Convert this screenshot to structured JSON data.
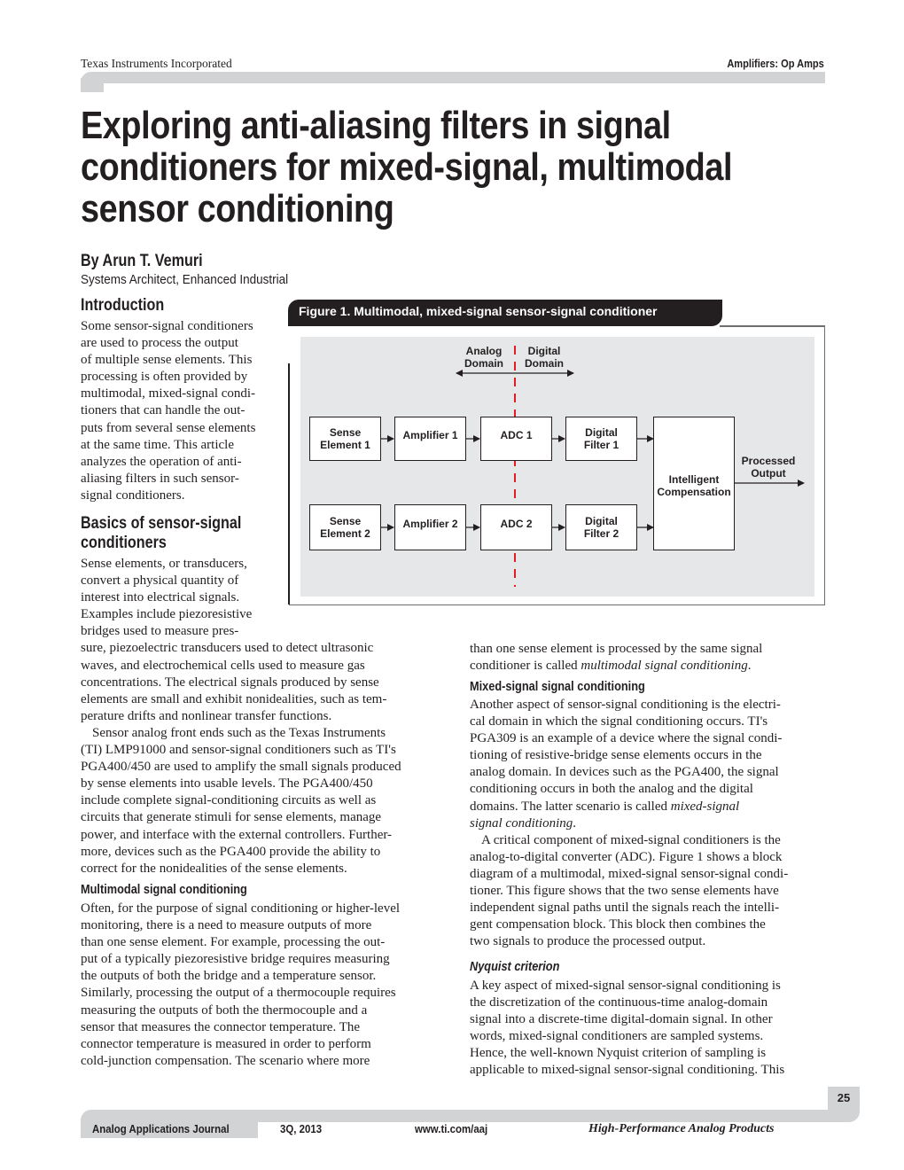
{
  "header": {
    "publisher": "Texas Instruments Incorporated",
    "category": "Amplifiers: Op Amps"
  },
  "article": {
    "title_lines": [
      "Exploring anti-aliasing filters in signal",
      "conditioners for mixed-signal, multimodal",
      "sensor conditioning"
    ],
    "author": "By Arun T. Vemuri",
    "author_title": "Systems Architect, Enhanced Industrial"
  },
  "sections": {
    "introduction": {
      "heading": "Introduction",
      "lines": [
        "Some sensor-signal conditioners",
        "are used to process the output",
        "of multiple sense elements. This",
        "processing is often provided by",
        "multimodal, mixed-signal condi-",
        "tioners that can handle the out-",
        "puts from several sense elements",
        "at the same time. This article",
        "analyzes the operation of anti-",
        "aliasing filters in such sensor-",
        "signal conditioners."
      ]
    },
    "basics": {
      "heading_lines": [
        "Basics of sensor-signal",
        "conditioners"
      ],
      "narrow_lines": [
        "Sense elements, or transducers,",
        "convert a physical quantity of",
        "interest into electrical signals.",
        "Examples include piezoresistive",
        "bridges used to measure pres-"
      ],
      "wide_lines": [
        "sure, piezoelectric transducers used to detect ultrasonic",
        "waves, and electrochemical cells used to measure gas",
        "concentrations. The electrical signals produced by sense",
        "elements are small and exhibit nonidealities, such as tem-",
        "perature drifts and nonlinear transfer functions."
      ],
      "para2_lines": [
        "Sensor analog front ends such as the Texas Instruments",
        "(TI) LMP91000 and sensor-signal conditioners such as TI's",
        "PGA400/450 are used to amplify the small signals produced",
        "by sense elements into usable levels. The PGA400/450",
        "include complete signal-conditioning circuits as well as",
        "circuits that generate stimuli for sense elements, manage",
        "power, and interface with the external controllers. Further-",
        "more, devices such as the PGA400 provide the ability to",
        "correct for the nonidealities of the sense elements."
      ]
    },
    "multimodal": {
      "heading": "Multimodal signal conditioning",
      "lines": [
        "Often, for the purpose of signal conditioning or higher-level",
        "monitoring, there is a need to measure outputs of more",
        "than one sense element. For example, processing the out-",
        "put of a typically piezoresistive bridge requires measuring",
        "the outputs of both the bridge and a temperature sensor.",
        "Similarly, processing the output of a thermocouple requires",
        "measuring the outputs of both the thermocouple and a",
        "sensor that measures the connector temperature. The",
        "connector temperature is measured in order to perform",
        "cold-junction compensation. The scenario where more"
      ],
      "cont_line1": "than one sense element is processed by the same signal",
      "cont_line2_prefix": "conditioner is called ",
      "cont_line2_italic": "multimodal signal conditioning",
      "cont_line2_suffix": "."
    },
    "mixed_signal": {
      "heading": "Mixed-signal signal conditioning",
      "lines": [
        "Another aspect of sensor-signal conditioning is the electri-",
        "cal domain in which the signal conditioning occurs. TI's",
        "PGA309 is an example of a device where the signal condi-",
        "tioning of resistive-bridge sense elements occurs in the",
        "analog domain. In devices such as the PGA400, the signal",
        "conditioning occurs in both the analog and the digital"
      ],
      "line7_prefix": "domains. The latter scenario is called ",
      "line7_italic": "mixed-signal",
      "line8_italic": "signal conditioning",
      "line8_suffix": ".",
      "para2_lines": [
        "A critical component of mixed-signal conditioners is the",
        "analog-to-digital converter (ADC). Figure 1 shows a block",
        "diagram of a multimodal, mixed-signal sensor-signal condi-",
        "tioner. This figure shows that the two sense elements have",
        "independent signal paths until the signals reach the intelli-",
        "gent compensation block. This block then combines the",
        "two signals to produce the processed output."
      ]
    },
    "nyquist": {
      "heading": "Nyquist criterion",
      "lines": [
        "A key aspect of mixed-signal sensor-signal conditioning is",
        "the discretization of the continuous-time analog-domain",
        "signal into a discrete-time digital-domain signal. In other",
        "words, mixed-signal conditioners are sampled systems.",
        "Hence, the well-known Nyquist criterion of sampling is",
        "applicable to mixed-signal sensor-signal conditioning. This"
      ]
    }
  },
  "figure": {
    "caption": "Figure 1. Multimodal, mixed-signal sensor-signal conditioner",
    "domain_labels": {
      "analog": [
        "Analog",
        "Domain"
      ],
      "digital": [
        "Digital",
        "Domain"
      ]
    },
    "channel1": {
      "sense": [
        "Sense",
        "Element 1"
      ],
      "amp": "Amplifier 1",
      "adc": "ADC 1",
      "filter": [
        "Digital",
        "Filter 1"
      ]
    },
    "channel2": {
      "sense": [
        "Sense",
        "Element 2"
      ],
      "amp": "Amplifier 2",
      "adc": "ADC 2",
      "filter": [
        "Digital",
        "Filter 2"
      ]
    },
    "compensation": [
      "Intelligent",
      "Compensation"
    ],
    "output": [
      "Processed",
      "Output"
    ],
    "divider_color": "#e31b23"
  },
  "footer": {
    "page_number": "25",
    "journal": "Analog Applications Journal",
    "issue": "3Q, 2013",
    "url": "www.ti.com/aaj",
    "product_line": "High-Performance Analog Products"
  }
}
